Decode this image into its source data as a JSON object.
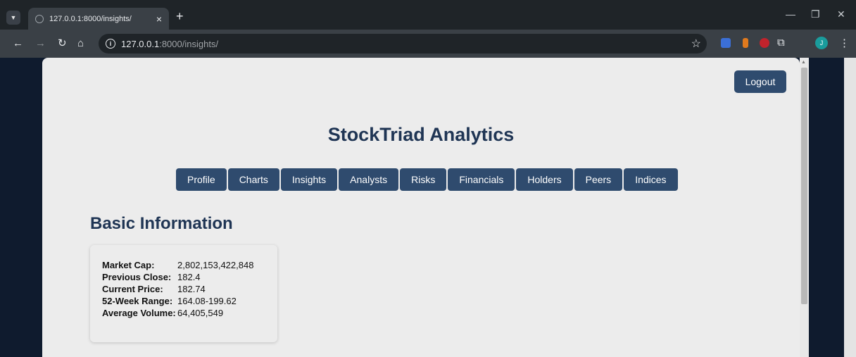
{
  "browser": {
    "tab_title": "127.0.0.1:8000/insights/",
    "url_host": "127.0.0.1",
    "url_path": ":8000/insights/",
    "profile_initial": "J"
  },
  "header": {
    "logout_label": "Logout",
    "title": "StockTriad Analytics"
  },
  "nav": {
    "items": [
      "Profile",
      "Charts",
      "Insights",
      "Analysts",
      "Risks",
      "Financials",
      "Holders",
      "Peers",
      "Indices"
    ]
  },
  "basic_info": {
    "title": "Basic Information",
    "rows": [
      {
        "label": "Market Cap:",
        "value": "2,802,153,422,848"
      },
      {
        "label": "Previous Close:",
        "value": "182.4"
      },
      {
        "label": "Current Price:",
        "value": "182.74"
      },
      {
        "label": "52-Week Range:",
        "value": "164.08-199.62"
      },
      {
        "label": "Average Volume:",
        "value": "64,405,549"
      }
    ]
  },
  "colors": {
    "primary": "#2f4b6e",
    "title": "#1f3554",
    "page_bg": "#ececec",
    "outer_bg": "#0f1b2e"
  }
}
